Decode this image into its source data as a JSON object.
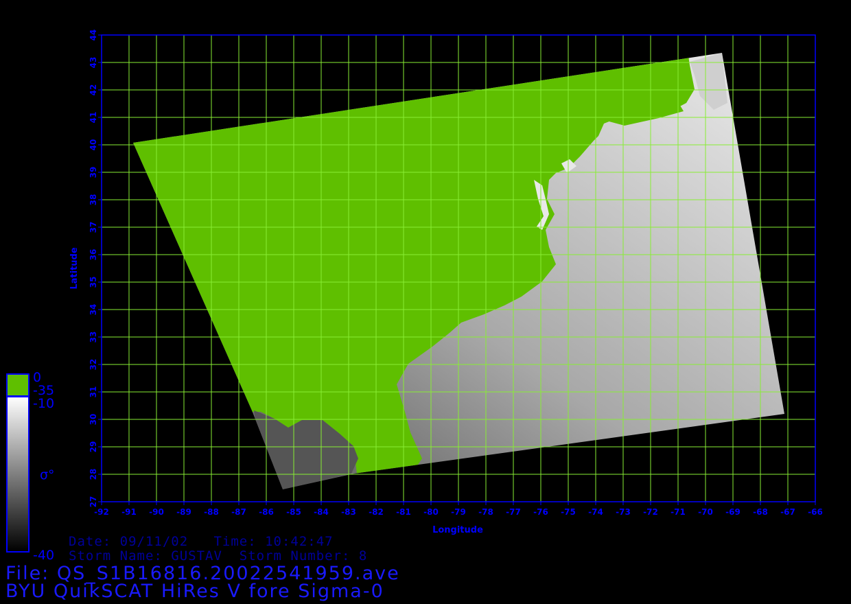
{
  "axes": {
    "xlabel": "Longitude",
    "ylabel": "Latitude",
    "xlim": [
      -92,
      -66
    ],
    "ylim": [
      27,
      44
    ],
    "x_ticks": [
      "-92",
      "-91",
      "-90",
      "-89",
      "-88",
      "-87",
      "-86",
      "-85",
      "-84",
      "-83",
      "-82",
      "-81",
      "-80",
      "-79",
      "-78",
      "-77",
      "-76",
      "-75",
      "-74",
      "-73",
      "-72",
      "-71",
      "-70",
      "-69",
      "-68",
      "-67",
      "-66"
    ],
    "y_ticks": [
      "27",
      "28",
      "29",
      "30",
      "31",
      "32",
      "33",
      "34",
      "35",
      "36",
      "37",
      "38",
      "39",
      "40",
      "41",
      "42",
      "43",
      "44"
    ],
    "grid": true,
    "grid_color": "#88ee33",
    "axis_color": "#0000ff"
  },
  "swath": {
    "corners_lonlat": [
      [
        -90.9,
        40.1
      ],
      [
        -68.7,
        43.4
      ],
      [
        -67.1,
        30.2
      ],
      [
        -84.6,
        27.5
      ]
    ],
    "land_color": "#5fbf00",
    "ocean_colors": [
      "#4a4a4a",
      "#eeeeee"
    ]
  },
  "colorbar": {
    "land_labels": [
      "0",
      "-35"
    ],
    "ocean_labels": [
      "-10",
      "-40"
    ],
    "symbol": "σ°",
    "land_color": "#5fbf00",
    "ocean_top_color": "#ffffff",
    "ocean_bottom_color": "#000000"
  },
  "info": {
    "date_line": "Date: 09/11/02   Time: 10:42:47",
    "storm_line": "Storm Name: GUSTAV  Storm Number: 8",
    "file_line": "File: QS_S1B16816.20022541959.ave",
    "title_line": "BYU QuikSCAT HiRes V fore Sigma-0"
  }
}
